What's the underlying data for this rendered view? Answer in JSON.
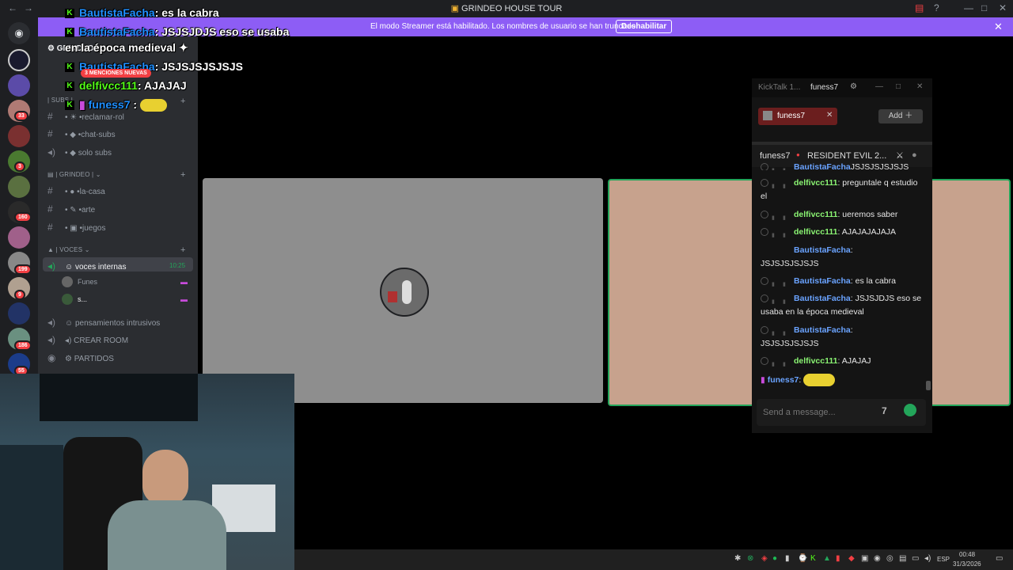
{
  "window": {
    "title": "GRINDEO HOUSE TOUR"
  },
  "banner": {
    "message": "El modo Streamer está habilitado. Los nombres de usuario se han truncado.",
    "button": "Deshabilitar"
  },
  "rail_badges": [
    "33",
    "3",
    "160",
    "199",
    "9",
    "186",
    "55"
  ],
  "server_header": "GRINDEO",
  "mentions_pill": "3 MENCIONES NUEVAS",
  "overlay_chat": [
    {
      "user": "BautistaFacha",
      "text": ": es la cabra"
    },
    {
      "user": "BautistaFacha",
      "text": ": JSJSJDJS eso se usaba"
    },
    {
      "user": "",
      "text": "en la época medieval"
    },
    {
      "user": "BautistaFacha",
      "text": ": JSJSJSJSJSJS"
    },
    {
      "user": "delfivcc111",
      "text": ": AJAJAJ"
    },
    {
      "user": "funess7",
      "text": " :"
    }
  ],
  "sidebar": {
    "cat_subs": "| SUBS |",
    "subs_items": [
      "•reclamar-rol",
      "•chat-subs",
      "solo subs"
    ],
    "cat_grindeo": "| GRINDEO |",
    "grindeo_items": [
      "•la-casa",
      "•arte",
      "•juegos"
    ],
    "cat_voces": "| VOCES",
    "voice_active": {
      "name": "voces internas",
      "time": "10:25"
    },
    "voice_users": [
      "Funes",
      "s..."
    ],
    "voice_others": [
      "pensamientos intrusivos",
      "CREAR ROOM",
      "PARTIDOS"
    ]
  },
  "kicktalk": {
    "tab1": "KickTalk 1...",
    "tab2": "funess7",
    "chip": "funess7",
    "add": "Add",
    "channel": "funess7",
    "stream_title": "RESIDENT EVIL 2...",
    "messages": [
      {
        "user": "BautistaFacha",
        "text": "JSJSJSJSJSJS",
        "kind": "n2"
      },
      {
        "user": "delfivcc111",
        "text": " preguntale q estudio el",
        "kind": "n1"
      },
      {
        "user": "delfivcc111",
        "text": " ueremos saber",
        "kind": "n1"
      },
      {
        "user": "delfivcc111",
        "text": " AJAJAJAJAJA",
        "kind": "n1"
      },
      {
        "user": "BautistaFacha",
        "text": " JSJSJSJSJSJS",
        "kind": "n2"
      },
      {
        "user": "BautistaFacha",
        "text": " es la cabra",
        "kind": "n2"
      },
      {
        "user": "BautistaFacha",
        "text": " JSJSJDJS eso se usaba en la época medieval",
        "kind": "n2"
      },
      {
        "user": "BautistaFacha",
        "text": " JSJSJSJSJSJS",
        "kind": "n2"
      },
      {
        "user": "delfivcc111",
        "text": " AJAJAJ",
        "kind": "n1"
      },
      {
        "user": "funess7",
        "text": "",
        "kind": "n2"
      }
    ],
    "send_placeholder": "Send a message..."
  },
  "taskbar": {
    "lang": "ESP",
    "time": "00:48",
    "date": "31/3/2026"
  },
  "colors": {
    "accent": "#8d5df5",
    "kick_green": "#53fc18",
    "discord_green": "#23a55a",
    "badge_red": "#f23f43"
  }
}
